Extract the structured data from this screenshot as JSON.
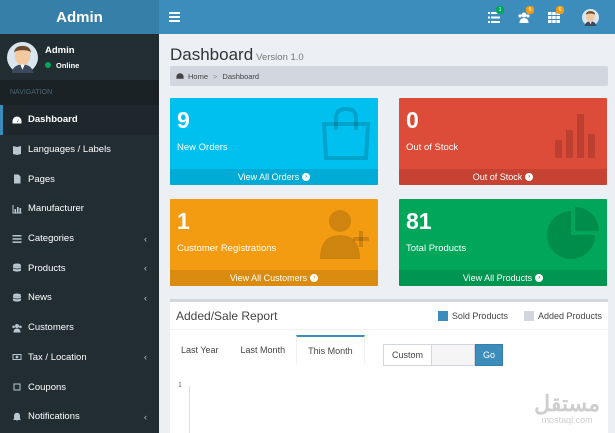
{
  "brand": "Admin",
  "header": {
    "badges": [
      "1",
      "6",
      "6"
    ]
  },
  "user": {
    "name": "Admin",
    "status": "Online"
  },
  "nav_header": "NAVIGATION",
  "nav": [
    {
      "label": "Dashboard",
      "icon": "dashboard-icon",
      "active": true
    },
    {
      "label": "Languages / Labels",
      "icon": "book-icon"
    },
    {
      "label": "Pages",
      "icon": "file-icon"
    },
    {
      "label": "Manufacturer",
      "icon": "bar-chart-icon"
    },
    {
      "label": "Categories",
      "icon": "list-icon",
      "chevron": "‹"
    },
    {
      "label": "Products",
      "icon": "database-icon",
      "chevron": "‹"
    },
    {
      "label": "News",
      "icon": "database-icon",
      "chevron": "‹"
    },
    {
      "label": "Customers",
      "icon": "users-icon"
    },
    {
      "label": "Tax / Location",
      "icon": "money-icon",
      "chevron": "‹"
    },
    {
      "label": "Coupons",
      "icon": "square-icon"
    },
    {
      "label": "Notifications",
      "icon": "bell-icon",
      "chevron": "‹"
    }
  ],
  "page": {
    "title": "Dashboard",
    "version": "Version 1.0"
  },
  "breadcrumb": {
    "home": "Home",
    "sep": ">",
    "current": "Dashboard"
  },
  "boxes": [
    {
      "value": "9",
      "label": "New Orders",
      "link": "View All Orders",
      "color": "#00c0ef",
      "icon": "shopping-bag-icon"
    },
    {
      "value": "0",
      "label": "Out of Stock",
      "link": "Out of Stock",
      "color": "#dd4b39",
      "icon": "bar-chart-icon"
    },
    {
      "value": "1",
      "label": "Customer Registrations",
      "link": "View All Customers",
      "color": "#f39c12",
      "icon": "user-plus-icon"
    },
    {
      "value": "81",
      "label": "Total Products",
      "link": "View All Products",
      "color": "#00a65a",
      "icon": "pie-chart-icon"
    }
  ],
  "report": {
    "title": "Added/Sale Report",
    "legend": [
      {
        "label": "Sold Products",
        "color": "#3c8dbc"
      },
      {
        "label": "Added Products",
        "color": "#d2d6de"
      }
    ],
    "tabs": [
      "Last Year",
      "Last Month",
      "This Month"
    ],
    "active_tab": 2,
    "custom_label": "Custom",
    "go_label": "Go",
    "y_tick": "1"
  },
  "watermark": {
    "arabic": "مستقل",
    "latin": "mostaql.com"
  }
}
